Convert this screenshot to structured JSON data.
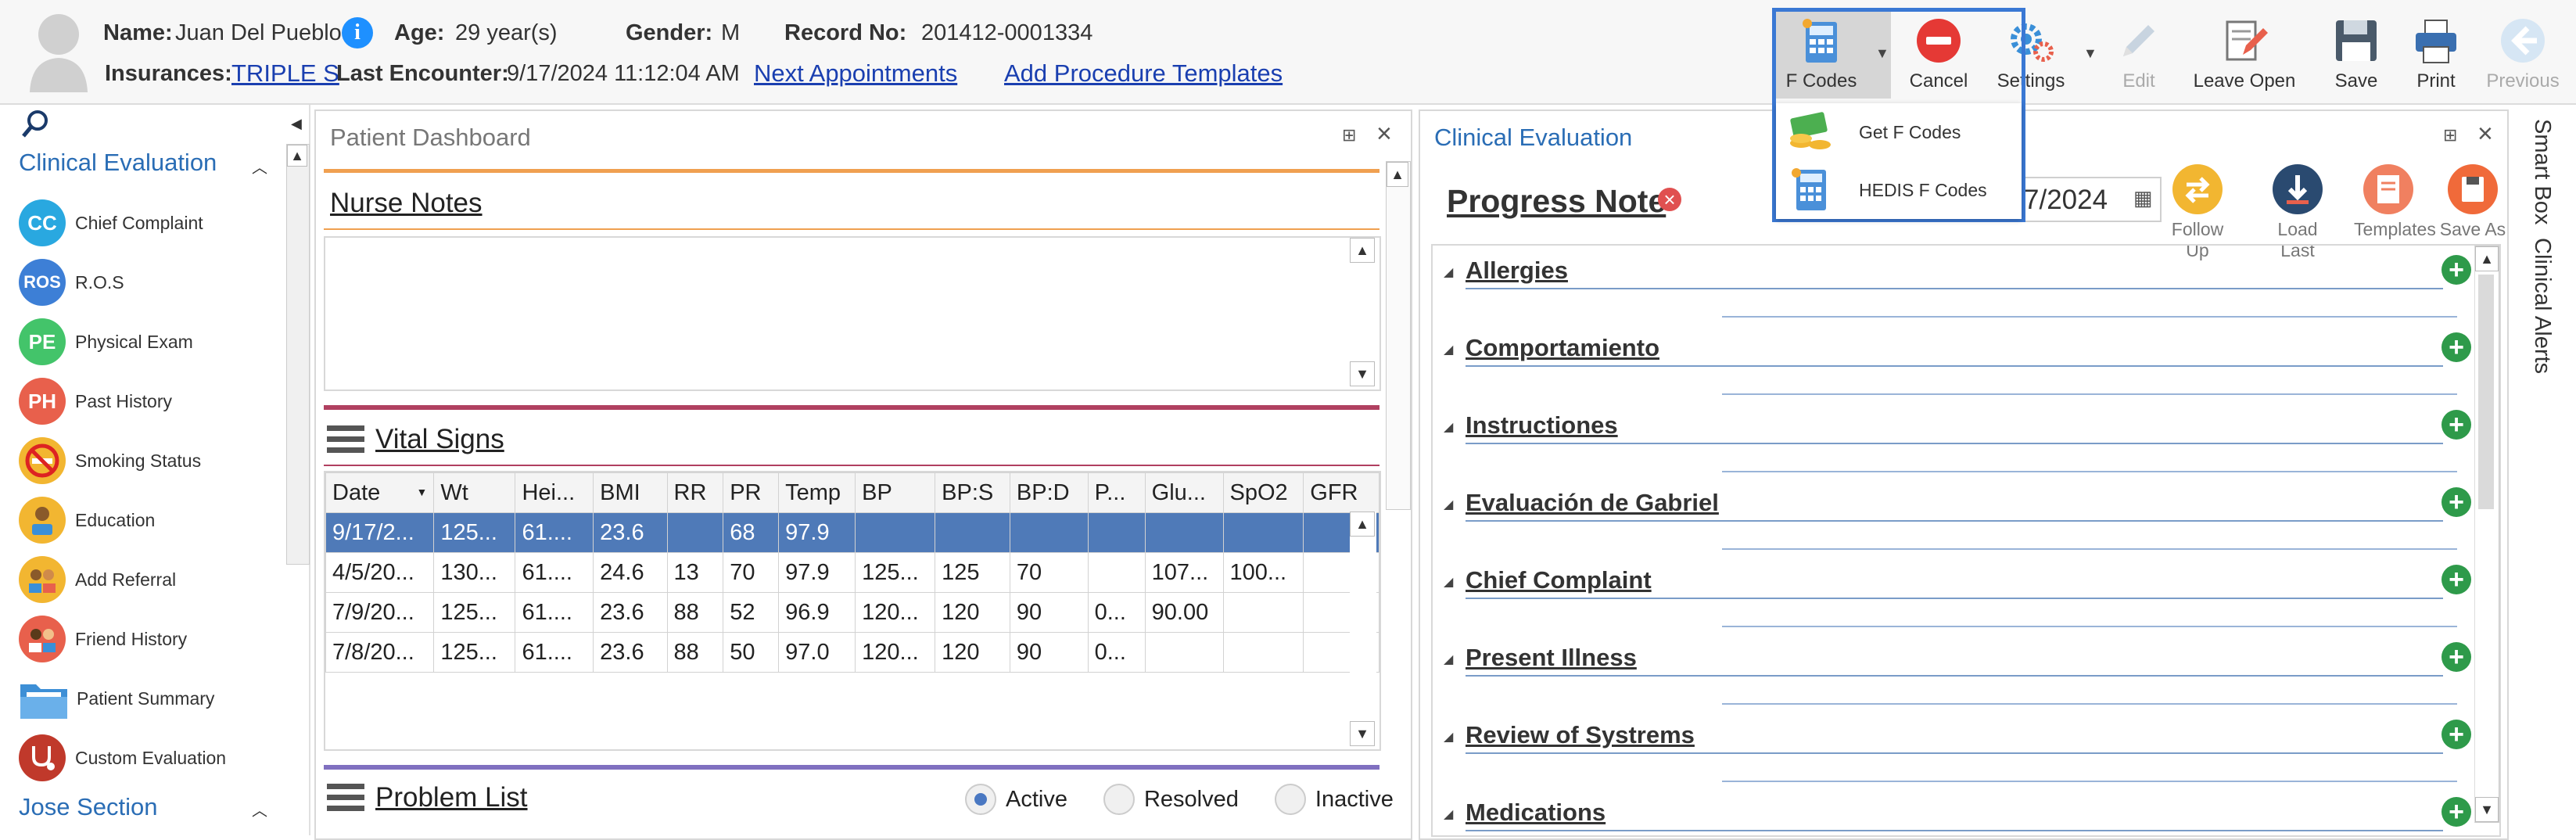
{
  "header": {
    "name_label": "Name:",
    "name": "Juan Del Pueblo",
    "age_label": "Age:",
    "age": "29 year(s)",
    "gender_label": "Gender:",
    "gender": "M",
    "record_label": "Record No:",
    "record": "201412-0001334",
    "insurances_label": "Insurances:",
    "insurance": "TRIPLE S",
    "last_encounter_label": "Last Encounter:",
    "last_encounter": "9/17/2024 11:12:04 AM",
    "next_appointments": "Next Appointments",
    "add_procedure_templates": "Add Procedure Templates"
  },
  "toolbar": {
    "fcodes": "F Codes",
    "cancel": "Cancel",
    "settings": "Settings",
    "edit": "Edit",
    "leave_open": "Leave Open",
    "save": "Save",
    "print": "Print",
    "previous": "Previous"
  },
  "fcodes_menu": {
    "items": [
      "Get F Codes",
      "HEDIS F Codes"
    ]
  },
  "sidebar": {
    "section1": "Clinical Evaluation",
    "items": [
      {
        "label": "Chief Complaint",
        "abbr": "CC",
        "color": "#29a8e0"
      },
      {
        "label": "R.O.S",
        "abbr": "ROS",
        "color": "#3d7fd6"
      },
      {
        "label": "Physical Exam",
        "abbr": "PE",
        "color": "#43c46a"
      },
      {
        "label": "Past History",
        "abbr": "PH",
        "color": "#e8604c"
      },
      {
        "label": "Smoking Status",
        "abbr": "",
        "color": "#f2b631"
      },
      {
        "label": "Education",
        "abbr": "",
        "color": "#f2b631"
      },
      {
        "label": "Add Referral",
        "abbr": "",
        "color": "#f2b631"
      },
      {
        "label": "Friend History",
        "abbr": "",
        "color": "#e8604c"
      },
      {
        "label": "Patient Summary",
        "abbr": "",
        "color": "#3d8fd6"
      },
      {
        "label": "Custom Evaluation",
        "abbr": "",
        "color": "#c0392b"
      }
    ],
    "section2": "Jose Section"
  },
  "dashboard": {
    "title": "Patient Dashboard",
    "nurse_notes": "Nurse Notes",
    "vital_signs": "Vital Signs",
    "problem_list": "Problem List",
    "radio_active": "Active",
    "radio_resolved": "Resolved",
    "radio_inactive": "Inactive"
  },
  "vitals": {
    "columns": [
      "Date",
      "Wt",
      "Hei...",
      "BMI",
      "RR",
      "PR",
      "Temp",
      "BP",
      "BP:S",
      "BP:D",
      "P...",
      "Glu...",
      "SpO2",
      "GFR"
    ],
    "rows": [
      [
        "9/17/2...",
        "125...",
        "61....",
        "23.6",
        "",
        "68",
        "97.9",
        "",
        "",
        "",
        "",
        "",
        "",
        ""
      ],
      [
        "4/5/20...",
        "130...",
        "61....",
        "24.6",
        "13",
        "70",
        "97.9",
        "125...",
        "125",
        "70",
        "",
        "107...",
        "100...",
        ""
      ],
      [
        "7/9/20...",
        "125...",
        "61....",
        "23.6",
        "88",
        "52",
        "96.9",
        "120...",
        "120",
        "90",
        "0...",
        "90.00",
        "",
        ""
      ],
      [
        "7/8/20...",
        "125...",
        "61....",
        "23.6",
        "88",
        "50",
        "97.0",
        "120...",
        "120",
        "90",
        "0...",
        "",
        "",
        ""
      ]
    ]
  },
  "clinical": {
    "title": "Clinical Evaluation",
    "progress_note": "Progress Note",
    "date_partial": "7/2024",
    "actions": [
      "Follow Up",
      "Load Last",
      "Templates",
      "Save As"
    ],
    "sections": [
      "Allergies",
      "Comportamiento",
      "Instructiones",
      "Evaluación de Gabriel",
      "Chief Complaint",
      "Present Illness",
      "Review of Systrems",
      "Medications"
    ]
  },
  "right_rail": {
    "smart_box": "Smart Box",
    "clinical_alerts": "Clinical Alerts"
  },
  "colors": {
    "accent_blue": "#2a6db5",
    "selection": "#4f7ab8",
    "orange_bar": "#f0a050",
    "maroon_bar": "#b04060",
    "purple_bar": "#8070c0",
    "plus_green": "#2e9a4a"
  }
}
